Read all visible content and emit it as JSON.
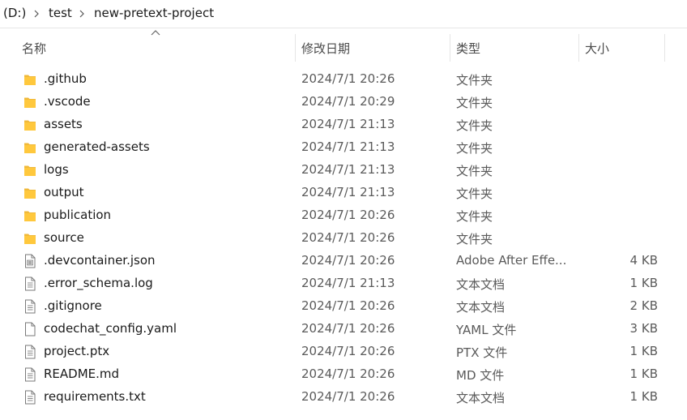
{
  "breadcrumb": {
    "drive": "(D:)",
    "folder1": "test",
    "folder2": "new-pretext-project"
  },
  "columns": {
    "name": "名称",
    "modified": "修改日期",
    "type": "类型",
    "size": "大小"
  },
  "files": [
    {
      "name": ".github",
      "date": "2024/7/1 20:26",
      "type": "文件夹",
      "size": "",
      "icon": "folder-icon"
    },
    {
      "name": ".vscode",
      "date": "2024/7/1 20:29",
      "type": "文件夹",
      "size": "",
      "icon": "folder-icon"
    },
    {
      "name": "assets",
      "date": "2024/7/1 21:13",
      "type": "文件夹",
      "size": "",
      "icon": "folder-icon"
    },
    {
      "name": "generated-assets",
      "date": "2024/7/1 21:13",
      "type": "文件夹",
      "size": "",
      "icon": "folder-icon"
    },
    {
      "name": "logs",
      "date": "2024/7/1 21:13",
      "type": "文件夹",
      "size": "",
      "icon": "folder-icon"
    },
    {
      "name": "output",
      "date": "2024/7/1 21:13",
      "type": "文件夹",
      "size": "",
      "icon": "folder-icon"
    },
    {
      "name": "publication",
      "date": "2024/7/1 20:26",
      "type": "文件夹",
      "size": "",
      "icon": "folder-icon"
    },
    {
      "name": "source",
      "date": "2024/7/1 20:26",
      "type": "文件夹",
      "size": "",
      "icon": "folder-icon"
    },
    {
      "name": ".devcontainer.json",
      "date": "2024/7/1 20:26",
      "type": "Adobe After Effe...",
      "size": "4 KB",
      "icon": "json-file-icon"
    },
    {
      "name": ".error_schema.log",
      "date": "2024/7/1 21:13",
      "type": "文本文档",
      "size": "1 KB",
      "icon": "text-file-icon"
    },
    {
      "name": ".gitignore",
      "date": "2024/7/1 20:26",
      "type": "文本文档",
      "size": "2 KB",
      "icon": "text-file-icon"
    },
    {
      "name": "codechat_config.yaml",
      "date": "2024/7/1 20:26",
      "type": "YAML 文件",
      "size": "3 KB",
      "icon": "blank-file-icon"
    },
    {
      "name": "project.ptx",
      "date": "2024/7/1 20:26",
      "type": "PTX 文件",
      "size": "1 KB",
      "icon": "text-file-icon"
    },
    {
      "name": "README.md",
      "date": "2024/7/1 20:26",
      "type": "MD 文件",
      "size": "1 KB",
      "icon": "text-file-icon"
    },
    {
      "name": "requirements.txt",
      "date": "2024/7/1 20:26",
      "type": "文本文档",
      "size": "1 KB",
      "icon": "text-file-icon"
    }
  ]
}
